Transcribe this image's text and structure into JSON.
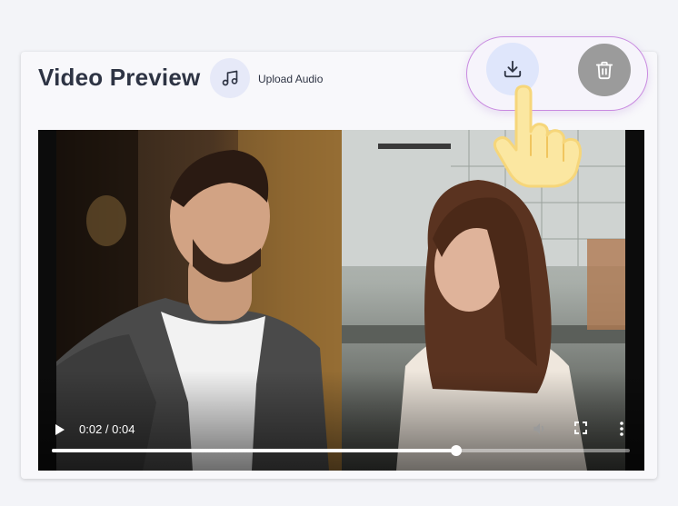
{
  "header": {
    "title": "Video Preview",
    "upload_audio_label": "Upload Audio",
    "music_icon": "music-note-icon",
    "download_icon": "download-icon",
    "delete_icon": "trash-icon"
  },
  "player": {
    "time_display": "0:02 / 0:04",
    "current_seconds": 2,
    "duration_seconds": 4,
    "progress_fraction": 0.7
  },
  "colors": {
    "accent_pill_border": "#c98ae0",
    "download_bg": "#dfe6fb",
    "delete_bg": "#9b9b9b",
    "title_text": "#2e3444",
    "cursor_fill": "#fbe7a1"
  }
}
